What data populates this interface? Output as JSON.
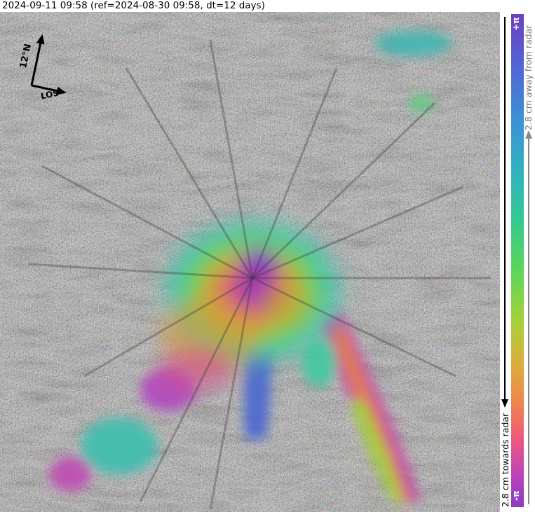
{
  "header": {
    "title": "2024-09-11 09:58 (ref=2024-08-30 09:58, dt=12 days)"
  },
  "compass": {
    "north_label": "12°N",
    "los_label": "LOS"
  },
  "colorbar": {
    "top_label": "+π",
    "bottom_label": "-π",
    "away_label": "2.8 cm away from radar",
    "towards_label": "2.8 cm towards radar",
    "colors": [
      "#6a3fbf",
      "#4f6bd6",
      "#3b93d4",
      "#2fb3c0",
      "#35c98f",
      "#5bd65a",
      "#a3d23a",
      "#d7b23a",
      "#ef8a4a",
      "#ef5a7a",
      "#c044b8",
      "#8a3cc4"
    ]
  }
}
